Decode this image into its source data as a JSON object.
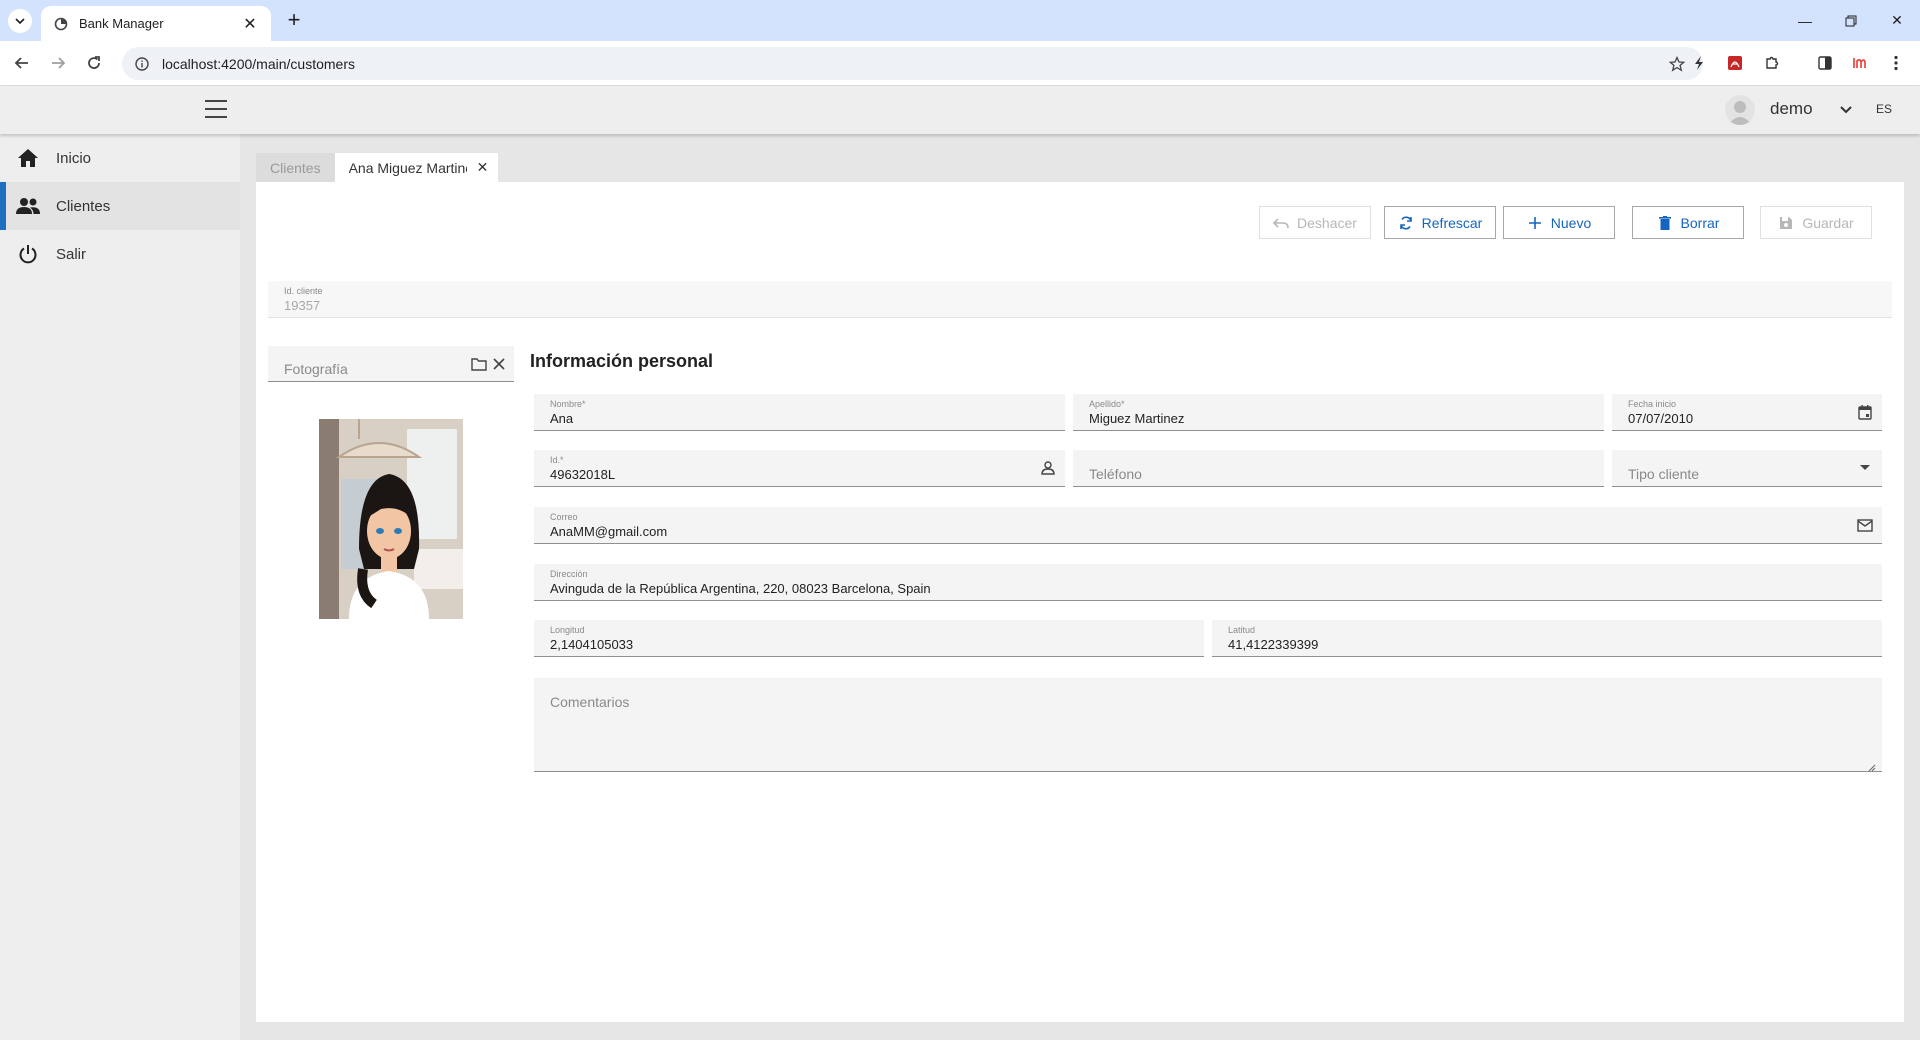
{
  "browser": {
    "tab_title": "Bank Manager",
    "url": "localhost:4200/main/customers"
  },
  "header": {
    "user_name": "demo",
    "language": "ES"
  },
  "sidebar": {
    "items": [
      {
        "label": "Inicio",
        "icon": "home-icon"
      },
      {
        "label": "Clientes",
        "icon": "people-icon"
      },
      {
        "label": "Salir",
        "icon": "power-icon"
      }
    ],
    "active_index": 1,
    "accent_color": "#1f6fc0"
  },
  "tabs": {
    "list_tab": "Clientes",
    "detail_tab": "Ana Miguez Martinez"
  },
  "actions": {
    "undo": "Deshacer",
    "refresh": "Refrescar",
    "new": "Nuevo",
    "delete": "Borrar",
    "save": "Guardar"
  },
  "customer": {
    "id_label": "Id. cliente",
    "id_value": "19357",
    "photo_placeholder": "Fotografía",
    "section_title": "Información personal",
    "name_label": "Nombre*",
    "name_value": "Ana",
    "surname_label": "Apellido*",
    "surname_value": "Miguez Martinez",
    "start_date_label": "Fecha inicio",
    "start_date_value": "07/07/2010",
    "doc_id_label": "Id.*",
    "doc_id_value": "49632018L",
    "phone_placeholder": "Teléfono",
    "customer_type_placeholder": "Tipo cliente",
    "email_label": "Correo",
    "email_value": "AnaMM@gmail.com",
    "address_label": "Dirección",
    "address_value": "Avinguda de la República Argentina, 220, 08023 Barcelona, Spain",
    "longitude_label": "Longitud",
    "longitude_value": "2,1404105033",
    "latitude_label": "Latitud",
    "latitude_value": "41,4122339399",
    "comments_placeholder": "Comentarios"
  }
}
